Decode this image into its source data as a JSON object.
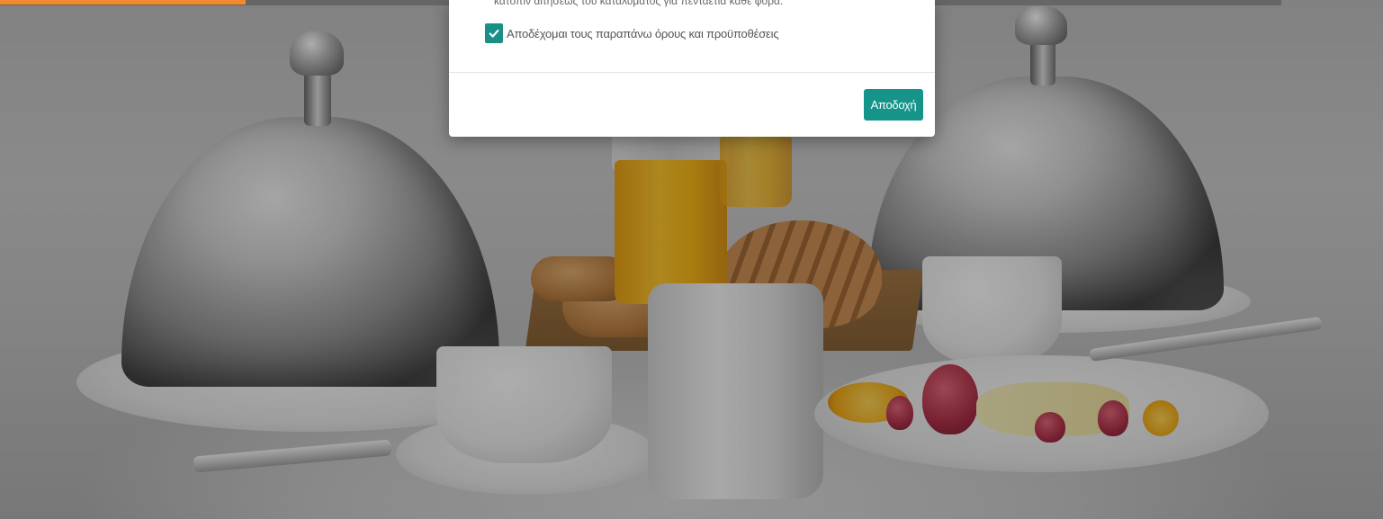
{
  "modal": {
    "terms_text": "κατόπιν αιτήσεως του καταλύματος για πενταετία κάθε φορά.",
    "accept_checkbox": {
      "checked": true,
      "label": "Αποδέχομαι τους παραπάνω όρους και προϋποθέσεις"
    },
    "accept_button_label": "Αποδοχή"
  },
  "colors": {
    "accent": "#f08a2a",
    "primary": "#16948a"
  },
  "icons": {
    "checkbox_mark": "check-icon"
  }
}
